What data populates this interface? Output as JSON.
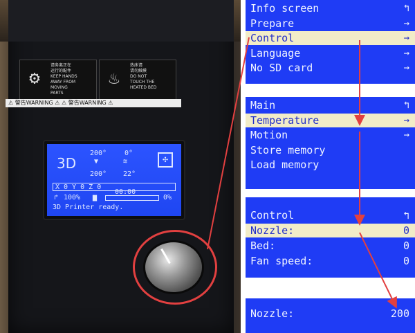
{
  "photo": {
    "warning_left": {
      "lines": "请务离正在\n运行的配件\nKEEP HANDS\nAWAY FROM\nMOVING\nPARTS"
    },
    "warning_right": {
      "lines": "热床请\n请勿触摸\nDO NOT\nTOUCH THE\nHEATED BED"
    },
    "warning_strip": "⚠ 警告WARNING ⚠  ⚠ 警告WARNING ⚠",
    "lcd": {
      "mode": "3D",
      "nozzle_target": "200°",
      "nozzle_current": "200°",
      "bed_target": "0°",
      "bed_current": "22°",
      "fan_icon": "fan-icon",
      "xyz": "X   0   Y   0   Z   0",
      "feedrate": "100%",
      "time": "00:00",
      "progress_text": "0%",
      "progress": 0,
      "status": "3D Printer ready."
    }
  },
  "screens": {
    "s1": [
      {
        "label": "Info screen",
        "arrow": "↰",
        "selected": false
      },
      {
        "label": "Prepare",
        "arrow": "→",
        "selected": false
      },
      {
        "label": "Control",
        "arrow": "→",
        "selected": true
      },
      {
        "label": "Language",
        "arrow": "→",
        "selected": false
      },
      {
        "label": "No SD card",
        "arrow": "→",
        "selected": false
      }
    ],
    "s2": [
      {
        "label": "Main",
        "arrow": "↰",
        "selected": false
      },
      {
        "label": "Temperature",
        "arrow": "→",
        "selected": true
      },
      {
        "label": "Motion",
        "arrow": "→",
        "selected": false
      },
      {
        "label": "Store memory",
        "arrow": "",
        "selected": false
      },
      {
        "label": "Load memory",
        "arrow": "",
        "selected": false
      }
    ],
    "s3": [
      {
        "label": "Control",
        "value": "↰",
        "selected": false
      },
      {
        "label": "Nozzle:",
        "value": "0",
        "selected": true
      },
      {
        "label": "Bed:",
        "value": "0",
        "selected": false
      },
      {
        "label": "Fan speed:",
        "value": "0",
        "selected": false
      }
    ],
    "s4": {
      "label": "Nozzle:",
      "value": "200"
    }
  },
  "colors": {
    "screen_bg": "#1f3cf5",
    "highlight_bg": "#f2ecc8",
    "arrow": "#e24040"
  }
}
